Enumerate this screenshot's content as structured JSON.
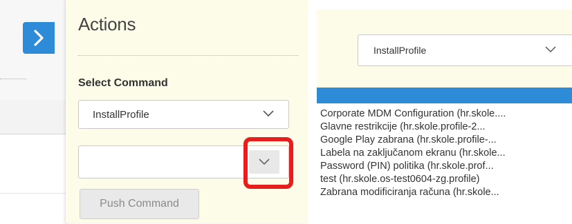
{
  "actions": {
    "title": "Actions",
    "select_label": "Select Command",
    "command_select": {
      "value": "InstallProfile"
    },
    "profile_select": {
      "value": ""
    },
    "push_button": "Push Command"
  },
  "zoom": {
    "command_select": {
      "value": "InstallProfile"
    },
    "options": [
      "Corporate MDM Configuration (hr.skole....",
      "Glavne restrikcije (hr.skole.profile-2...",
      "Google Play zabrana (hr.skole.profile-...",
      "Labela na zaključanom ekranu (hr.skole...",
      "Password (PIN) politika (hr.skole.prof...",
      "test (hr.skole.os-test0604-zg.profile)",
      "Zabrana modificiranja računa (hr.skole..."
    ]
  },
  "colors": {
    "accent": "#2e8bd8",
    "panel": "#fcfce9",
    "highlight": "#e61e1e"
  },
  "icons": {
    "expand": "chevron-right-icon",
    "dropdown": "chevron-down-icon"
  }
}
